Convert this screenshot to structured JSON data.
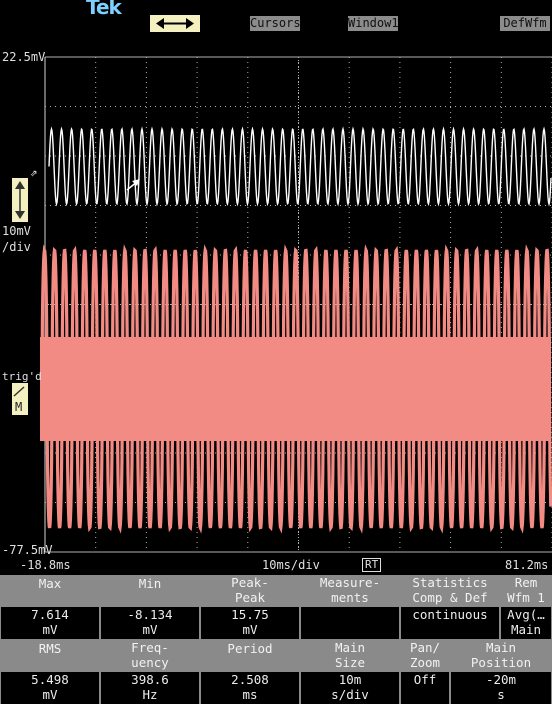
{
  "header": {
    "brand": "Tek",
    "menu": [
      "Cursors",
      "Window1",
      "DefWfm"
    ]
  },
  "scope": {
    "top_value": "22.5mV",
    "bottom_value": "-77.5mV",
    "scale_value": "10mV",
    "scale_unit": "/div",
    "trigger_status": "trig'd",
    "math_marker": "M",
    "time_left": "-18.8ms",
    "time_center": "10ms/div",
    "rt_badge": "RT",
    "time_right": "81.2ms",
    "colors": {
      "ch1": "#ffffff",
      "math": "#f28b83",
      "grid": "#b0b0b0",
      "accent": "#f4f0c0"
    }
  },
  "measurements": {
    "row1": [
      {
        "header": [
          "Max"
        ],
        "value": [
          "7.614",
          "mV"
        ]
      },
      {
        "header": [
          "Min"
        ],
        "value": [
          "-8.134",
          "mV"
        ]
      },
      {
        "header": [
          "Peak-",
          "Peak"
        ],
        "value": [
          "15.75",
          "mV"
        ]
      },
      {
        "header": [
          "Measure-",
          "ments"
        ],
        "value": [
          "",
          ""
        ]
      },
      {
        "header": [
          "Statistics",
          "Comp & Def"
        ],
        "value": [
          "continuous",
          ""
        ]
      },
      {
        "header": [
          "Rem",
          "Wfm 1"
        ],
        "value": [
          "Avg(…",
          "Main"
        ]
      }
    ],
    "row2": [
      {
        "header": [
          "RMS"
        ],
        "value": [
          "5.498",
          "mV"
        ]
      },
      {
        "header": [
          "Freq-",
          "uency"
        ],
        "value": [
          "398.6",
          "Hz"
        ]
      },
      {
        "header": [
          "Period"
        ],
        "value": [
          "2.508",
          "ms"
        ]
      },
      {
        "header": [
          "Main",
          "Size"
        ],
        "value": [
          "10m",
          "s/div"
        ]
      },
      {
        "header": [
          "Pan/",
          "Zoom"
        ],
        "value": [
          "Off",
          ""
        ]
      },
      {
        "header": [
          "Main",
          "Position"
        ],
        "value": [
          "-20m",
          "s"
        ]
      }
    ]
  }
}
